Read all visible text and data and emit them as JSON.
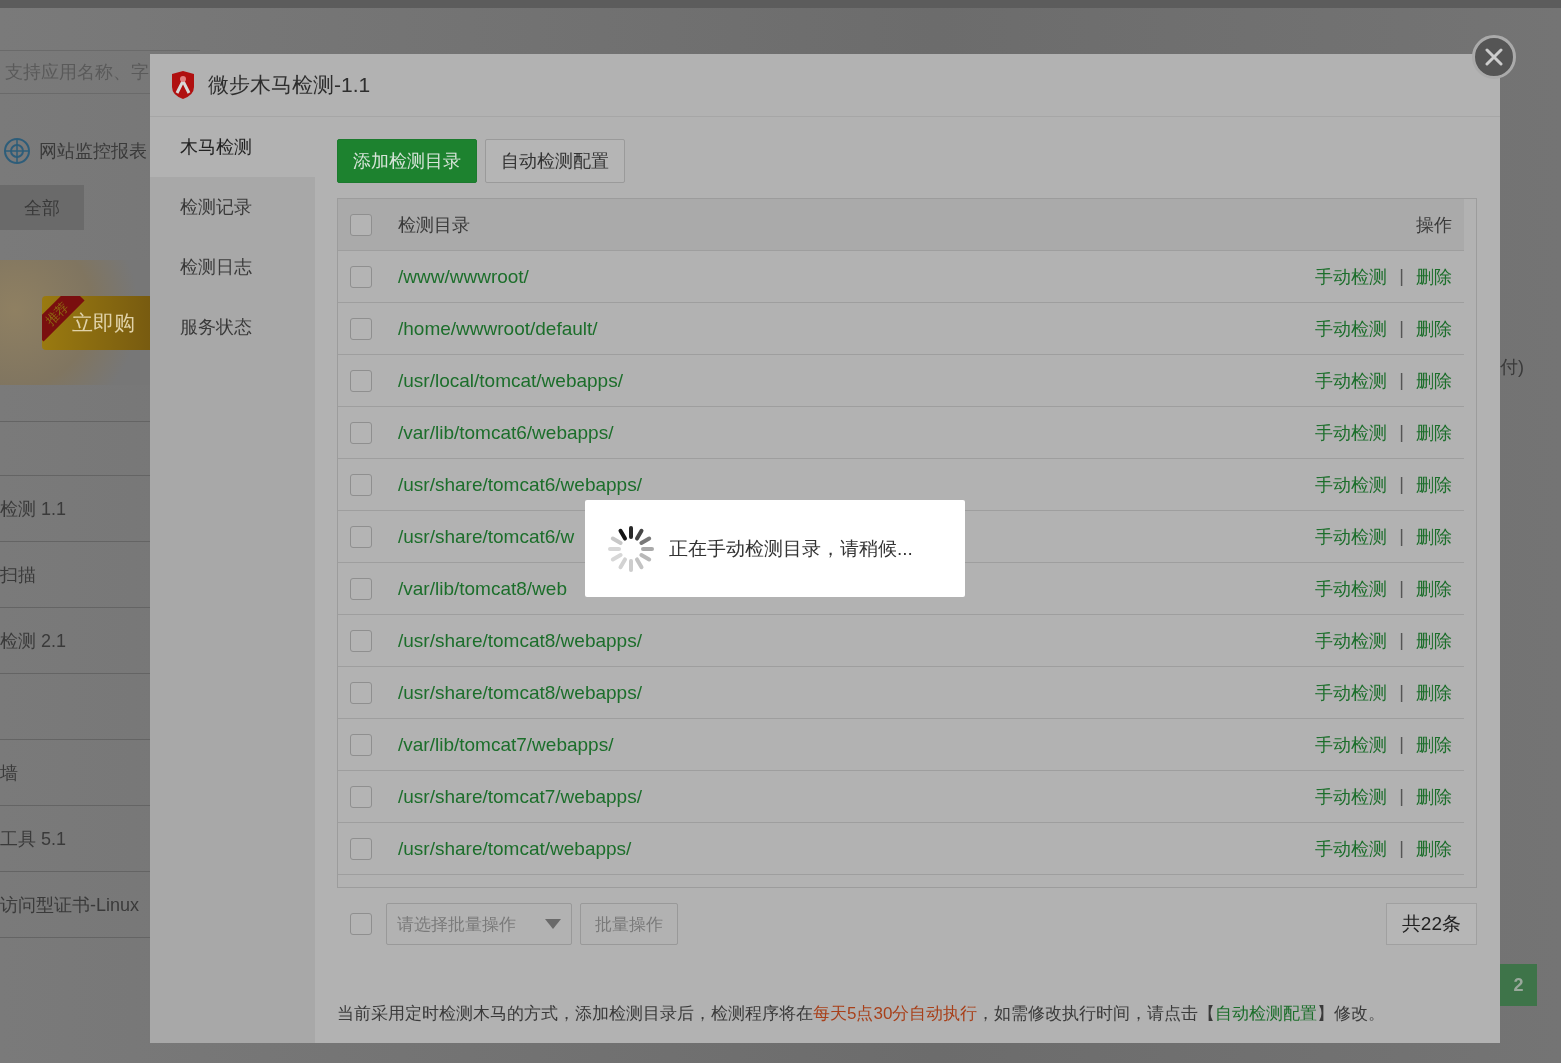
{
  "background": {
    "search": {
      "placeholder": "支持应用名称、字"
    },
    "report_link": "网站监控报表",
    "filters": [
      {
        "label": "全部"
      }
    ],
    "banner": {
      "ribbon": "推荐",
      "button": "立即购"
    },
    "side_note": "付)",
    "list": [
      {
        "kind": "entry",
        "label": "检测 1.1"
      },
      {
        "kind": "entry",
        "label": "扫描"
      },
      {
        "kind": "entry",
        "label": "检测 2.1"
      },
      {
        "kind": "blank"
      },
      {
        "kind": "entry",
        "label": "墙"
      },
      {
        "kind": "entry",
        "label": "工具 5.1"
      },
      {
        "kind": "entry",
        "label": "访问型证书-Linux"
      }
    ],
    "page": "2"
  },
  "modal": {
    "title": "微步木马检测-1.1",
    "nav": [
      {
        "label": "木马检测",
        "selected": true
      },
      {
        "label": "检测记录",
        "selected": false
      },
      {
        "label": "检测日志",
        "selected": false
      },
      {
        "label": "服务状态",
        "selected": false
      }
    ],
    "toolbar": [
      {
        "label": "添加检测目录",
        "kind": "primary"
      },
      {
        "label": "自动检测配置",
        "kind": "default"
      }
    ],
    "table": {
      "columns": [
        "检测目录",
        "操作"
      ],
      "header_checked": false,
      "rows": [
        {
          "path": "/www/wwwroot/",
          "checked": false,
          "manual": "手动检测",
          "separator": "|",
          "delete": "删除"
        },
        {
          "path": "/home/wwwroot/default/",
          "checked": false,
          "manual": "手动检测",
          "separator": "|",
          "delete": "删除"
        },
        {
          "path": "/usr/local/tomcat/webapps/",
          "checked": false,
          "manual": "手动检测",
          "separator": "|",
          "delete": "删除"
        },
        {
          "path": "/var/lib/tomcat6/webapps/",
          "checked": false,
          "manual": "手动检测",
          "separator": "|",
          "delete": "删除"
        },
        {
          "path": "/usr/share/tomcat6/webapps/",
          "checked": false,
          "manual": "手动检测",
          "separator": "|",
          "delete": "删除"
        },
        {
          "path": "/usr/share/tomcat6/w",
          "checked": false,
          "manual": "手动检测",
          "separator": "|",
          "delete": "删除"
        },
        {
          "path": "/var/lib/tomcat8/web",
          "checked": false,
          "manual": "手动检测",
          "separator": "|",
          "delete": "删除"
        },
        {
          "path": "/usr/share/tomcat8/webapps/",
          "checked": false,
          "manual": "手动检测",
          "separator": "|",
          "delete": "删除"
        },
        {
          "path": "/usr/share/tomcat8/webapps/",
          "checked": false,
          "manual": "手动检测",
          "separator": "|",
          "delete": "删除"
        },
        {
          "path": "/var/lib/tomcat7/webapps/",
          "checked": false,
          "manual": "手动检测",
          "separator": "|",
          "delete": "删除"
        },
        {
          "path": "/usr/share/tomcat7/webapps/",
          "checked": false,
          "manual": "手动检测",
          "separator": "|",
          "delete": "删除"
        },
        {
          "path": "/usr/share/tomcat/webapps/",
          "checked": false,
          "manual": "手动检测",
          "separator": "|",
          "delete": "删除"
        }
      ]
    },
    "footer": {
      "checked": false,
      "select_placeholder": "请选择批量操作",
      "batch_button": "批量操作",
      "total": "共22条"
    },
    "note": [
      {
        "text": "当前采用定时检测木马的方式，添加检测目录后，检测程序将在",
        "kind": "plain"
      },
      {
        "text": "每天5点30分自动执行",
        "kind": "highlight"
      },
      {
        "text": "，如需修改执行时间，请点击【",
        "kind": "plain"
      },
      {
        "text": "自动检测配置",
        "kind": "link"
      },
      {
        "text": "】修改。",
        "kind": "plain"
      }
    ]
  },
  "toast": {
    "message": "正在手动检测目录，请稍候..."
  }
}
